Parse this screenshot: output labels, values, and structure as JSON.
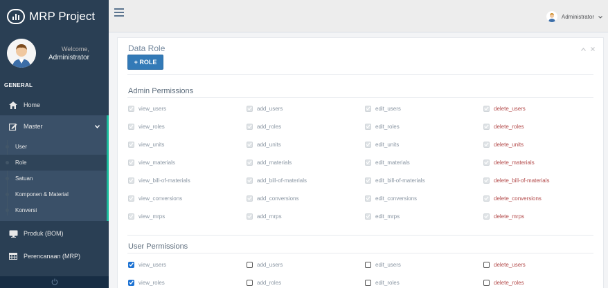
{
  "brand": {
    "title": "MRP Project"
  },
  "profile": {
    "welcome": "Welcome,",
    "name": "Administrator"
  },
  "sidebar": {
    "section": "GENERAL",
    "home": "Home",
    "master": "Master",
    "sub_items": [
      "User",
      "Role",
      "Satuan",
      "Komponen & Material",
      "Konversi"
    ],
    "produk": "Produk (BOM)",
    "perencanaan": "Perencanaan (MRP)"
  },
  "topbar": {
    "user": "Administrator"
  },
  "panel": {
    "title": "Data Role",
    "add_button": "+ ROLE",
    "tools": [
      "^",
      "x"
    ]
  },
  "admin_permissions": {
    "title": "Admin Permissions",
    "rows": [
      [
        "view_users",
        "add_users",
        "edit_users",
        "delete_users"
      ],
      [
        "view_roles",
        "add_roles",
        "edit_roles",
        "delete_roles"
      ],
      [
        "view_units",
        "add_units",
        "edit_units",
        "delete_units"
      ],
      [
        "view_materials",
        "add_materials",
        "edit_materials",
        "delete_materials"
      ],
      [
        "view_bill-of-materials",
        "add_bill-of-materials",
        "edit_bill-of-materials",
        "delete_bill-of-materials"
      ],
      [
        "view_conversions",
        "add_conversions",
        "edit_conversions",
        "delete_conversions"
      ],
      [
        "view_mrps",
        "add_mrps",
        "edit_mrps",
        "delete_mrps"
      ]
    ]
  },
  "user_permissions": {
    "title": "User Permissions",
    "rows": [
      {
        "labels": [
          "view_users",
          "add_users",
          "edit_users",
          "delete_users"
        ],
        "checked": [
          true,
          false,
          false,
          false
        ]
      },
      {
        "labels": [
          "view_roles",
          "add_roles",
          "edit_roles",
          "delete_roles"
        ],
        "checked": [
          true,
          false,
          false,
          false
        ]
      }
    ]
  },
  "colors": {
    "sidebar": "#2a3f54",
    "accent": "#1abb9c",
    "button": "#337ab7",
    "delete": "#b34a4a"
  }
}
